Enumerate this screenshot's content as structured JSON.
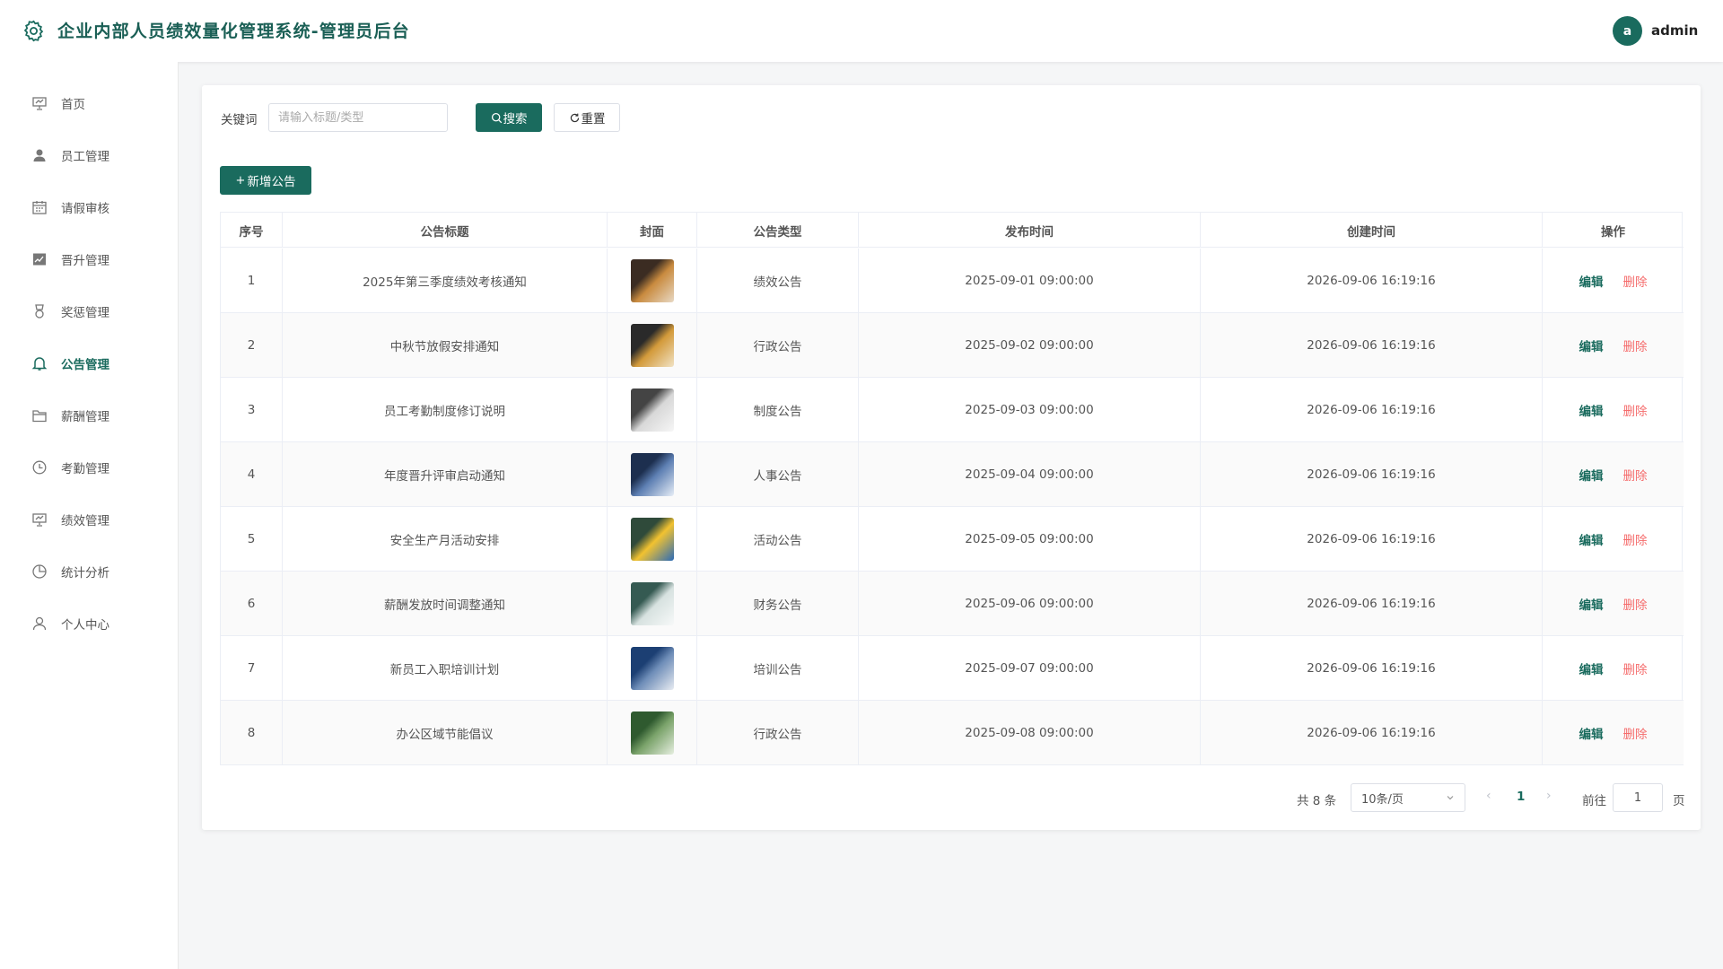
{
  "header": {
    "title": "企业内部人员绩效量化管理系统-管理员后台",
    "avatar_letter": "a",
    "username": "admin"
  },
  "sidebar": {
    "items": [
      {
        "label": "首页",
        "icon": "presentation-icon",
        "active": false
      },
      {
        "label": "员工管理",
        "icon": "user-icon",
        "active": false
      },
      {
        "label": "请假审核",
        "icon": "calendar-icon",
        "active": false
      },
      {
        "label": "晋升管理",
        "icon": "trend-chart-icon",
        "active": false
      },
      {
        "label": "奖惩管理",
        "icon": "medal-icon",
        "active": false
      },
      {
        "label": "公告管理",
        "icon": "bell-icon",
        "active": true
      },
      {
        "label": "薪酬管理",
        "icon": "folder-icon",
        "active": false
      },
      {
        "label": "考勤管理",
        "icon": "clock-icon",
        "active": false
      },
      {
        "label": "绩效管理",
        "icon": "presentation-icon",
        "active": false
      },
      {
        "label": "统计分析",
        "icon": "pie-chart-icon",
        "active": false
      },
      {
        "label": "个人中心",
        "icon": "user-outline-icon",
        "active": false
      }
    ]
  },
  "search": {
    "label": "关键词",
    "placeholder": "请输入标题/类型",
    "search_label": "搜索",
    "reset_label": "重置",
    "add_label": "新增公告"
  },
  "table": {
    "headers": [
      "序号",
      "公告标题",
      "封面",
      "公告类型",
      "发布时间",
      "创建时间",
      "操作"
    ],
    "edit_label": "编辑",
    "delete_label": "删除",
    "rows": [
      {
        "no": "1",
        "title": "2025年第三季度绩效考核通知",
        "type": "绩效公告",
        "publish": "2025-09-01 09:00:00",
        "created": "2026-09-06 16:19:16",
        "thumb": [
          "#3b2c22",
          "#c98b3f",
          "#e8d9c4"
        ]
      },
      {
        "no": "2",
        "title": "中秋节放假安排通知",
        "type": "行政公告",
        "publish": "2025-09-02 09:00:00",
        "created": "2026-09-06 16:19:16",
        "thumb": [
          "#2a2a2a",
          "#d39a3a",
          "#f1e3c5"
        ]
      },
      {
        "no": "3",
        "title": "员工考勤制度修订说明",
        "type": "制度公告",
        "publish": "2025-09-03 09:00:00",
        "created": "2026-09-06 16:19:16",
        "thumb": [
          "#444",
          "#d8d8d8",
          "#f6f6f6"
        ]
      },
      {
        "no": "4",
        "title": "年度晋升评审启动通知",
        "type": "人事公告",
        "publish": "2025-09-04 09:00:00",
        "created": "2026-09-06 16:19:16",
        "thumb": [
          "#1d2f4f",
          "#5d7fb3",
          "#e7eef7"
        ]
      },
      {
        "no": "5",
        "title": "安全生产月活动安排",
        "type": "活动公告",
        "publish": "2025-09-05 09:00:00",
        "created": "2026-09-06 16:19:16",
        "thumb": [
          "#2f4a3a",
          "#f2c230",
          "#2a6bb8"
        ]
      },
      {
        "no": "6",
        "title": "薪酬发放时间调整通知",
        "type": "财务公告",
        "publish": "2025-09-06 09:00:00",
        "created": "2026-09-06 16:19:16",
        "thumb": [
          "#355a52",
          "#d7e2e0",
          "#f7f9f9"
        ]
      },
      {
        "no": "7",
        "title": "新员工入职培训计划",
        "type": "培训公告",
        "publish": "2025-09-07 09:00:00",
        "created": "2026-09-06 16:19:16",
        "thumb": [
          "#1c3f73",
          "#6e8db8",
          "#e8ecf2"
        ]
      },
      {
        "no": "8",
        "title": "办公区域节能倡议",
        "type": "行政公告",
        "publish": "2025-09-08 09:00:00",
        "created": "2026-09-06 16:19:16",
        "thumb": [
          "#2f5a2f",
          "#7aa36a",
          "#e6efe0"
        ]
      }
    ]
  },
  "pagination": {
    "total": "共 8 条",
    "page_size": "10条/页",
    "current": "1",
    "goto_label": "前往",
    "goto_value": "1",
    "page_label": "页"
  },
  "colors": {
    "primary": "#1a6b5e",
    "danger": "#f56c6c"
  }
}
